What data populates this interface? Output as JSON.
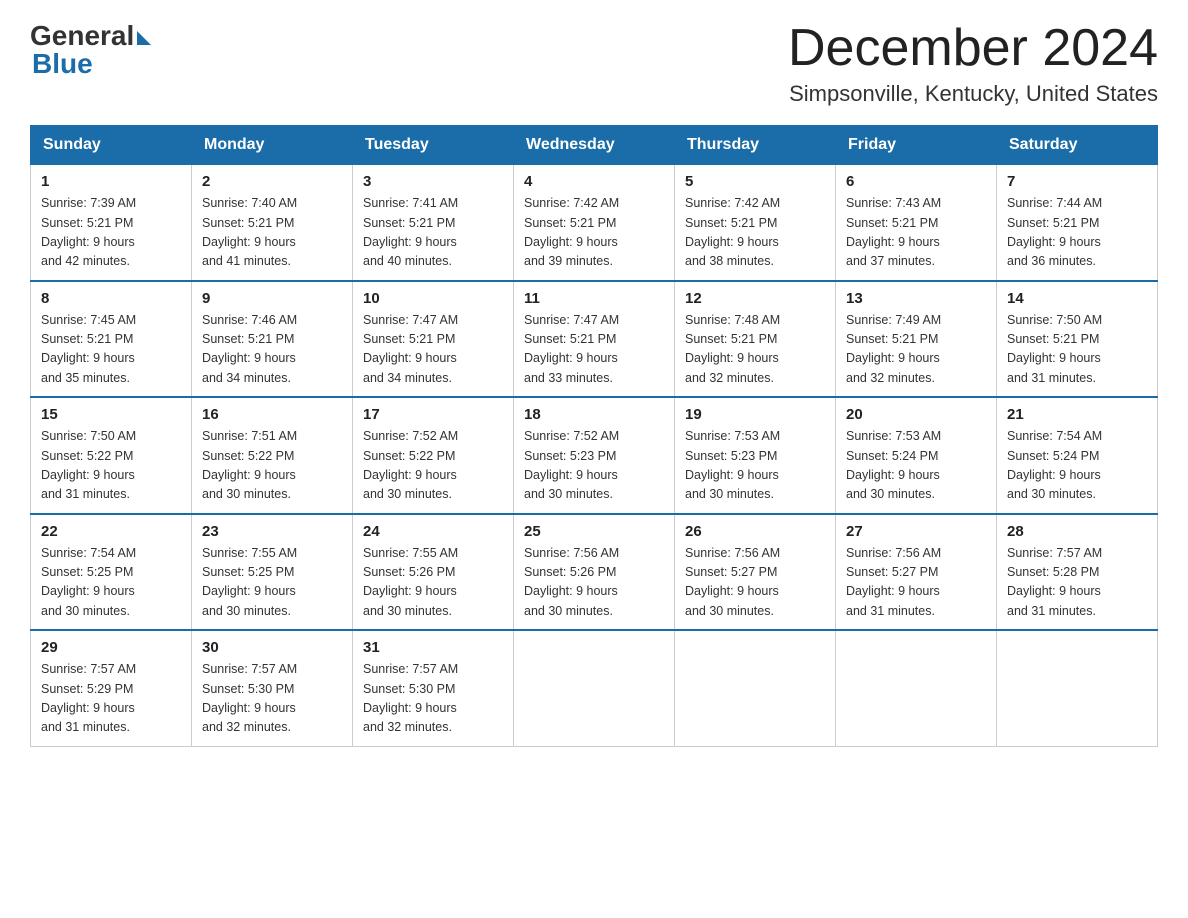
{
  "header": {
    "logo_text_general": "General",
    "logo_text_blue": "Blue",
    "month_title": "December 2024",
    "location": "Simpsonville, Kentucky, United States"
  },
  "days_of_week": [
    "Sunday",
    "Monday",
    "Tuesday",
    "Wednesday",
    "Thursday",
    "Friday",
    "Saturday"
  ],
  "weeks": [
    [
      {
        "day": "1",
        "sunrise": "7:39 AM",
        "sunset": "5:21 PM",
        "daylight": "9 hours and 42 minutes."
      },
      {
        "day": "2",
        "sunrise": "7:40 AM",
        "sunset": "5:21 PM",
        "daylight": "9 hours and 41 minutes."
      },
      {
        "day": "3",
        "sunrise": "7:41 AM",
        "sunset": "5:21 PM",
        "daylight": "9 hours and 40 minutes."
      },
      {
        "day": "4",
        "sunrise": "7:42 AM",
        "sunset": "5:21 PM",
        "daylight": "9 hours and 39 minutes."
      },
      {
        "day": "5",
        "sunrise": "7:42 AM",
        "sunset": "5:21 PM",
        "daylight": "9 hours and 38 minutes."
      },
      {
        "day": "6",
        "sunrise": "7:43 AM",
        "sunset": "5:21 PM",
        "daylight": "9 hours and 37 minutes."
      },
      {
        "day": "7",
        "sunrise": "7:44 AM",
        "sunset": "5:21 PM",
        "daylight": "9 hours and 36 minutes."
      }
    ],
    [
      {
        "day": "8",
        "sunrise": "7:45 AM",
        "sunset": "5:21 PM",
        "daylight": "9 hours and 35 minutes."
      },
      {
        "day": "9",
        "sunrise": "7:46 AM",
        "sunset": "5:21 PM",
        "daylight": "9 hours and 34 minutes."
      },
      {
        "day": "10",
        "sunrise": "7:47 AM",
        "sunset": "5:21 PM",
        "daylight": "9 hours and 34 minutes."
      },
      {
        "day": "11",
        "sunrise": "7:47 AM",
        "sunset": "5:21 PM",
        "daylight": "9 hours and 33 minutes."
      },
      {
        "day": "12",
        "sunrise": "7:48 AM",
        "sunset": "5:21 PM",
        "daylight": "9 hours and 32 minutes."
      },
      {
        "day": "13",
        "sunrise": "7:49 AM",
        "sunset": "5:21 PM",
        "daylight": "9 hours and 32 minutes."
      },
      {
        "day": "14",
        "sunrise": "7:50 AM",
        "sunset": "5:21 PM",
        "daylight": "9 hours and 31 minutes."
      }
    ],
    [
      {
        "day": "15",
        "sunrise": "7:50 AM",
        "sunset": "5:22 PM",
        "daylight": "9 hours and 31 minutes."
      },
      {
        "day": "16",
        "sunrise": "7:51 AM",
        "sunset": "5:22 PM",
        "daylight": "9 hours and 30 minutes."
      },
      {
        "day": "17",
        "sunrise": "7:52 AM",
        "sunset": "5:22 PM",
        "daylight": "9 hours and 30 minutes."
      },
      {
        "day": "18",
        "sunrise": "7:52 AM",
        "sunset": "5:23 PM",
        "daylight": "9 hours and 30 minutes."
      },
      {
        "day": "19",
        "sunrise": "7:53 AM",
        "sunset": "5:23 PM",
        "daylight": "9 hours and 30 minutes."
      },
      {
        "day": "20",
        "sunrise": "7:53 AM",
        "sunset": "5:24 PM",
        "daylight": "9 hours and 30 minutes."
      },
      {
        "day": "21",
        "sunrise": "7:54 AM",
        "sunset": "5:24 PM",
        "daylight": "9 hours and 30 minutes."
      }
    ],
    [
      {
        "day": "22",
        "sunrise": "7:54 AM",
        "sunset": "5:25 PM",
        "daylight": "9 hours and 30 minutes."
      },
      {
        "day": "23",
        "sunrise": "7:55 AM",
        "sunset": "5:25 PM",
        "daylight": "9 hours and 30 minutes."
      },
      {
        "day": "24",
        "sunrise": "7:55 AM",
        "sunset": "5:26 PM",
        "daylight": "9 hours and 30 minutes."
      },
      {
        "day": "25",
        "sunrise": "7:56 AM",
        "sunset": "5:26 PM",
        "daylight": "9 hours and 30 minutes."
      },
      {
        "day": "26",
        "sunrise": "7:56 AM",
        "sunset": "5:27 PM",
        "daylight": "9 hours and 30 minutes."
      },
      {
        "day": "27",
        "sunrise": "7:56 AM",
        "sunset": "5:27 PM",
        "daylight": "9 hours and 31 minutes."
      },
      {
        "day": "28",
        "sunrise": "7:57 AM",
        "sunset": "5:28 PM",
        "daylight": "9 hours and 31 minutes."
      }
    ],
    [
      {
        "day": "29",
        "sunrise": "7:57 AM",
        "sunset": "5:29 PM",
        "daylight": "9 hours and 31 minutes."
      },
      {
        "day": "30",
        "sunrise": "7:57 AM",
        "sunset": "5:30 PM",
        "daylight": "9 hours and 32 minutes."
      },
      {
        "day": "31",
        "sunrise": "7:57 AM",
        "sunset": "5:30 PM",
        "daylight": "9 hours and 32 minutes."
      },
      null,
      null,
      null,
      null
    ]
  ],
  "labels": {
    "sunrise": "Sunrise:",
    "sunset": "Sunset:",
    "daylight": "Daylight:"
  }
}
